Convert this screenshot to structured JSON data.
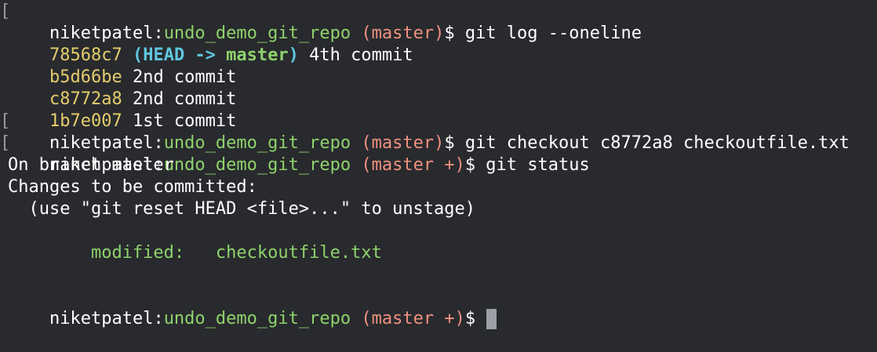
{
  "prompt": {
    "user": "niketpatel",
    "colon": ":",
    "repo": "undo_demo_git_repo",
    "branch_clean": "(master)",
    "branch_staged": "(master +)",
    "dollar": "$",
    "left_bracket": "["
  },
  "lines": [
    {
      "type": "prompt",
      "branch": "(master)",
      "command": " git log --oneline",
      "bracket": true
    },
    {
      "type": "log",
      "hash": "78568c7",
      "open_paren": " (",
      "head": "HEAD -> ",
      "master": "master",
      "close_paren": ")",
      "message": " 4th commit"
    },
    {
      "type": "log",
      "hash": "b5d66be",
      "message": " 2nd commit"
    },
    {
      "type": "log",
      "hash": "c8772a8",
      "message": " 2nd commit"
    },
    {
      "type": "log",
      "hash": "1b7e007",
      "message": " 1st commit"
    },
    {
      "type": "prompt",
      "branch": "(master)",
      "command": " git checkout c8772a8 checkoutfile.txt",
      "bracket": true
    },
    {
      "type": "prompt",
      "branch": "(master +)",
      "command": " git status",
      "bracket": true
    },
    {
      "type": "text",
      "text": "On branch master"
    },
    {
      "type": "text",
      "text": "Changes to be committed:"
    },
    {
      "type": "text",
      "text": "  (use \"git reset HEAD <file>...\" to unstage)"
    },
    {
      "type": "text",
      "text": ""
    },
    {
      "type": "modified",
      "label": "        modified:   checkoutfile.txt"
    },
    {
      "type": "text",
      "text": ""
    },
    {
      "type": "prompt",
      "branch": "(master +)",
      "command": " ",
      "bracket": false,
      "cursor": true
    }
  ]
}
